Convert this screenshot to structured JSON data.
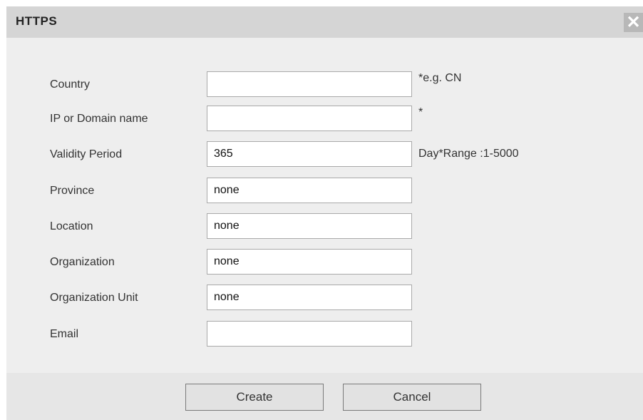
{
  "dialog": {
    "title": "HTTPS",
    "close_icon": "close-icon",
    "close_glyph": "✕"
  },
  "form": {
    "fields": [
      {
        "label": "Country",
        "value": "",
        "hint": "*e.g. CN"
      },
      {
        "label": "IP or Domain name",
        "value": "",
        "hint": "*"
      },
      {
        "label": "Validity Period",
        "value": "365",
        "hint": "Day*Range :1-5000"
      },
      {
        "label": "Province",
        "value": "none",
        "hint": ""
      },
      {
        "label": "Location",
        "value": "none",
        "hint": ""
      },
      {
        "label": "Organization",
        "value": "none",
        "hint": ""
      },
      {
        "label": "Organization Unit",
        "value": "none",
        "hint": ""
      },
      {
        "label": "Email",
        "value": "",
        "hint": ""
      }
    ]
  },
  "buttons": {
    "create_label": "Create",
    "cancel_label": "Cancel"
  }
}
